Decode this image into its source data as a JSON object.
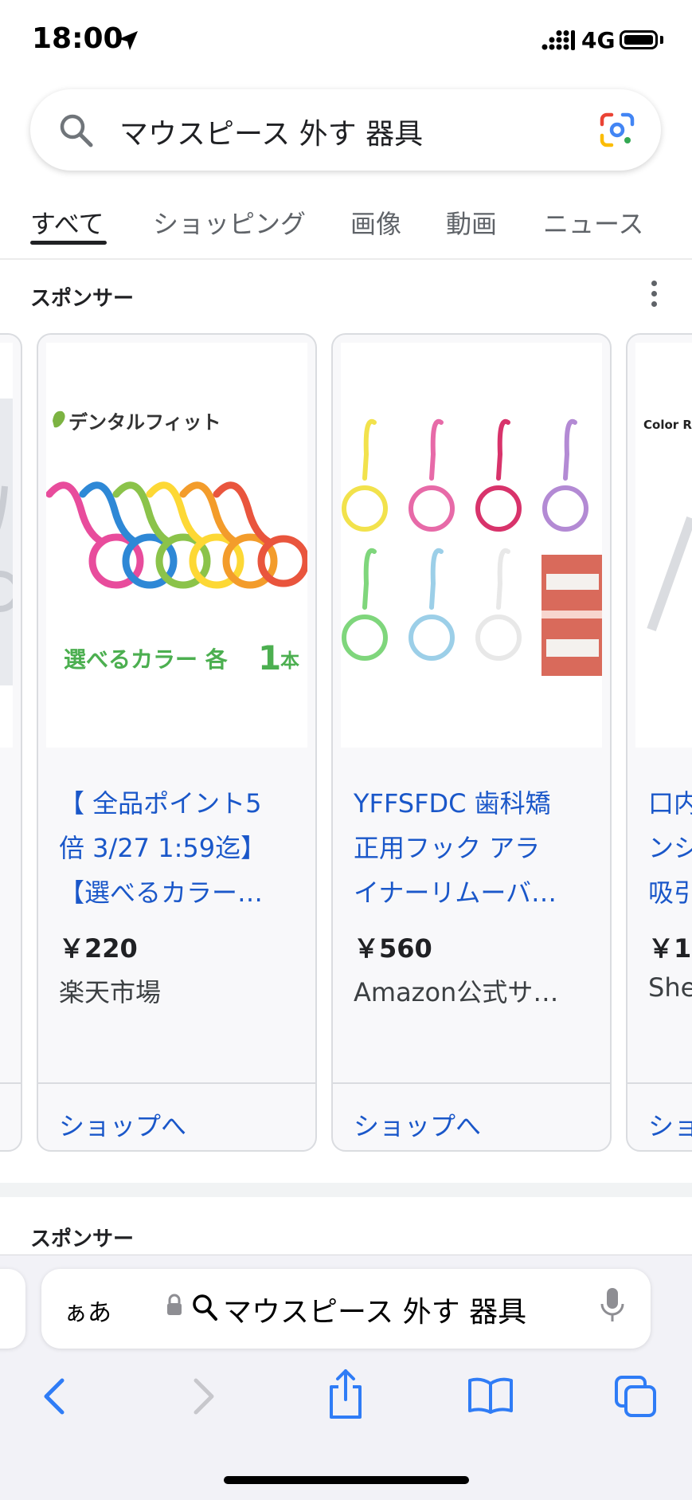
{
  "status_bar": {
    "time": "18:00",
    "network": "4G"
  },
  "search": {
    "query": "マウスピース 外す 器具"
  },
  "tabs": [
    {
      "label": "すべて",
      "active": true
    },
    {
      "label": "ショッピング",
      "active": false
    },
    {
      "label": "画像",
      "active": false
    },
    {
      "label": "動画",
      "active": false
    },
    {
      "label": "ニュース",
      "active": false
    }
  ],
  "sponsored_section": {
    "label": "スポンサー",
    "products": [
      {
        "title_lines": [
          "【 全品ポイント5",
          "倍 3/27 1:59迄】",
          "【選べるカラー…"
        ],
        "price": "￥220",
        "seller": "楽天市場",
        "shop_label": "ショップへ",
        "image_text_brand": "デンタルフィット",
        "image_text_caption_a": "選べるカラー  各",
        "image_text_caption_b": "1",
        "image_text_caption_c": "本"
      },
      {
        "title_lines": [
          "YFFSFDC 歯科矯",
          "正用フック アラ",
          "イナーリムーバ…"
        ],
        "price": "￥560",
        "seller": "Amazon公式サ…",
        "shop_label": "ショップへ"
      },
      {
        "title_lines": [
          "口内",
          "ンシ",
          "吸引"
        ],
        "price": "￥1",
        "seller": "She",
        "shop_label": "ショ",
        "image_text_brand": "Color Ra"
      }
    ]
  },
  "second_sponsored_label": "スポンサー",
  "safari": {
    "aa_label": "ぁあ",
    "url_text": "マウスピース 外す 器具"
  },
  "colors": {
    "link_blue": "#1a57c9",
    "google_blue": "#4285f4",
    "google_red": "#ea4335",
    "google_yellow": "#fbbc05",
    "google_green": "#34a853",
    "safari_blue": "#2f7cf6"
  }
}
